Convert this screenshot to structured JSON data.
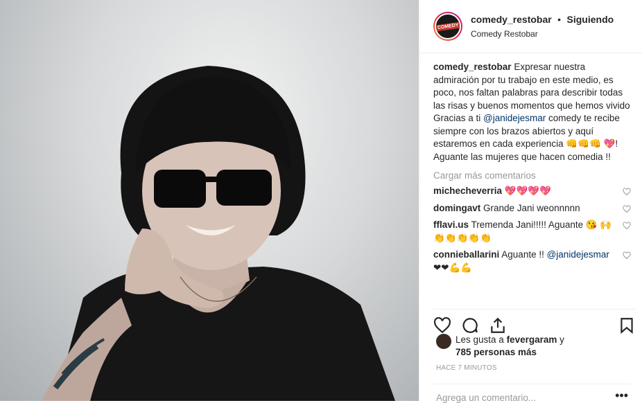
{
  "header": {
    "username": "comedy_restobar",
    "separator": "•",
    "follow_status": "Siguiendo",
    "location": "Comedy Restobar",
    "avatar_text": "COMEDY"
  },
  "caption": {
    "username": "comedy_restobar",
    "text_before": " Expresar nuestra admiración por tu trabajo en este medio, es poco, nos faltan palabras para describir todas las risas y buenos momentos que hemos vivido Gracias a ti ",
    "mention": "@janidejesmar",
    "text_after": " comedy te recibe siempre con los brazos abiertos y aquí estaremos en cada experiencia ",
    "emojis": "👊👊👊 💖!",
    "line2": "Aguante las mujeres que hacen comedia !!"
  },
  "load_more": "Cargar más comentarios",
  "comments": [
    {
      "user": "michecheverria",
      "text": " 💖💖💖💖"
    },
    {
      "user": "domingavt",
      "text": " Grande Jani weonnnnn"
    },
    {
      "user": "fflavi.us",
      "text": " Tremenda Jani!!!!! Aguante 😘 🙌👏👏👏👏👏"
    },
    {
      "user": "connieballarini",
      "text": " Aguante !! ",
      "mention": "@janidejesmar",
      "tail": " ❤❤💪💪"
    }
  ],
  "likes": {
    "prefix": "Les gusta a ",
    "user": "fevergaram",
    "middle": " y",
    "count": "785 personas más"
  },
  "timestamp": "HACE 7 MINUTOS",
  "add_comment_placeholder": "Agrega un comentario...",
  "more_options": "•••"
}
